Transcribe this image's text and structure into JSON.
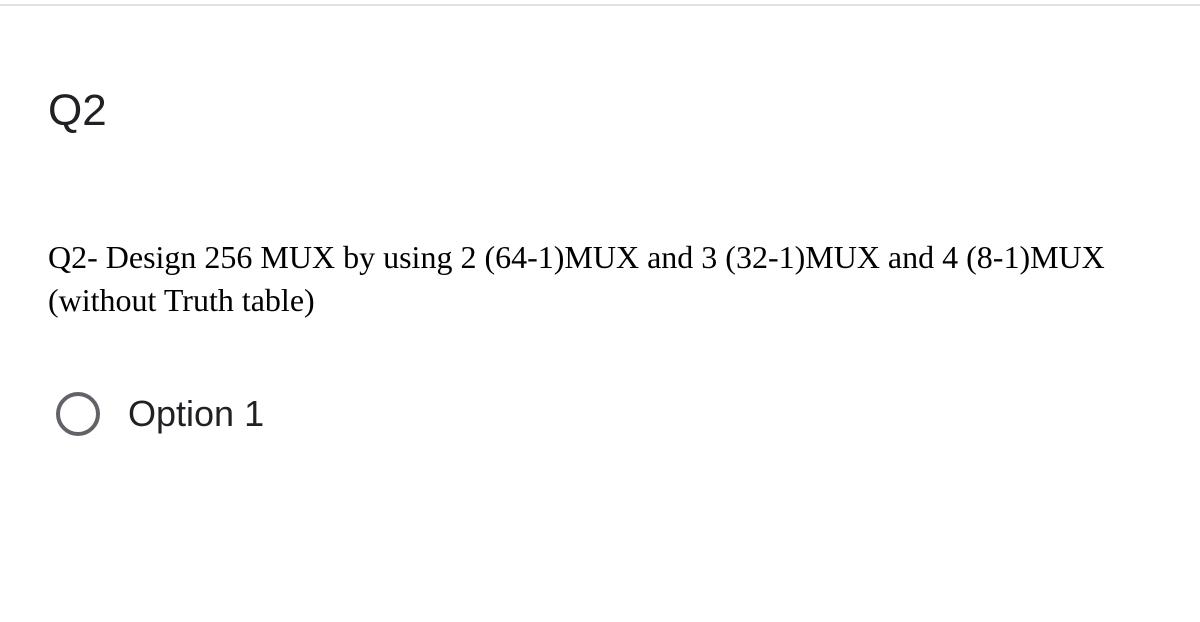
{
  "question": {
    "number": "Q2",
    "prompt": "Q2- Design 256 MUX by using 2 (64-1)MUX and 3 (32-1)MUX and 4 (8-1)MUX (without Truth table)"
  },
  "options": [
    {
      "label": "Option 1",
      "selected": false
    }
  ]
}
